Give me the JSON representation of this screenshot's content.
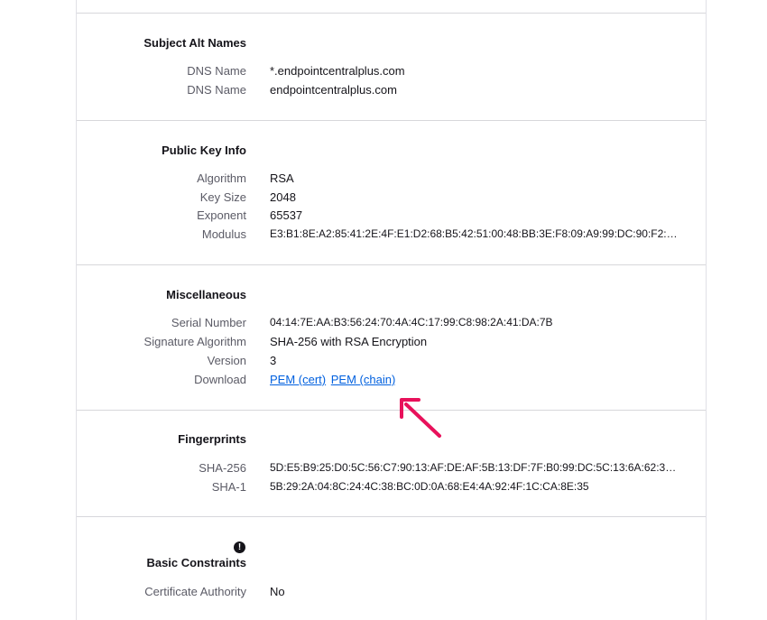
{
  "sections": {
    "subject_alt_names": {
      "title": "Subject Alt Names",
      "rows": [
        {
          "label": "DNS Name",
          "value": "*.endpointcentralplus.com"
        },
        {
          "label": "DNS Name",
          "value": "endpointcentralplus.com"
        }
      ]
    },
    "public_key_info": {
      "title": "Public Key Info",
      "rows": [
        {
          "label": "Algorithm",
          "value": "RSA"
        },
        {
          "label": "Key Size",
          "value": "2048"
        },
        {
          "label": "Exponent",
          "value": "65537"
        },
        {
          "label": "Modulus",
          "value": "E3:B1:8E:A2:85:41:2E:4F:E1:D2:68:B5:42:51:00:48:BB:3E:F8:09:A9:99:DC:90:F2:7A:..."
        }
      ]
    },
    "miscellaneous": {
      "title": "Miscellaneous",
      "rows": [
        {
          "label": "Serial Number",
          "value": "04:14:7E:AA:B3:56:24:70:4A:4C:17:99:C8:98:2A:41:DA:7B"
        },
        {
          "label": "Signature Algorithm",
          "value": "SHA-256 with RSA Encryption"
        },
        {
          "label": "Version",
          "value": "3"
        }
      ],
      "download": {
        "label": "Download",
        "pem_cert": "PEM (cert)",
        "pem_chain": "PEM (chain)"
      }
    },
    "fingerprints": {
      "title": "Fingerprints",
      "rows": [
        {
          "label": "SHA-256",
          "value": "5D:E5:B9:25:D0:5C:56:C7:90:13:AF:DE:AF:5B:13:DF:7F:B0:99:DC:5C:13:6A:62:32:2..."
        },
        {
          "label": "SHA-1",
          "value": "5B:29:2A:04:8C:24:4C:38:BC:0D:0A:68:E4:4A:92:4F:1C:CA:8E:35"
        }
      ]
    },
    "basic_constraints": {
      "title": "Basic Constraints",
      "info_icon": "!",
      "rows": [
        {
          "label": "Certificate Authority",
          "value": "No"
        }
      ]
    }
  },
  "colors": {
    "link": "#0060df",
    "annotation_arrow": "#e8115b",
    "label": "#5b5b66"
  },
  "icons": {
    "info": "info-icon",
    "annotation": "arrow-icon"
  }
}
